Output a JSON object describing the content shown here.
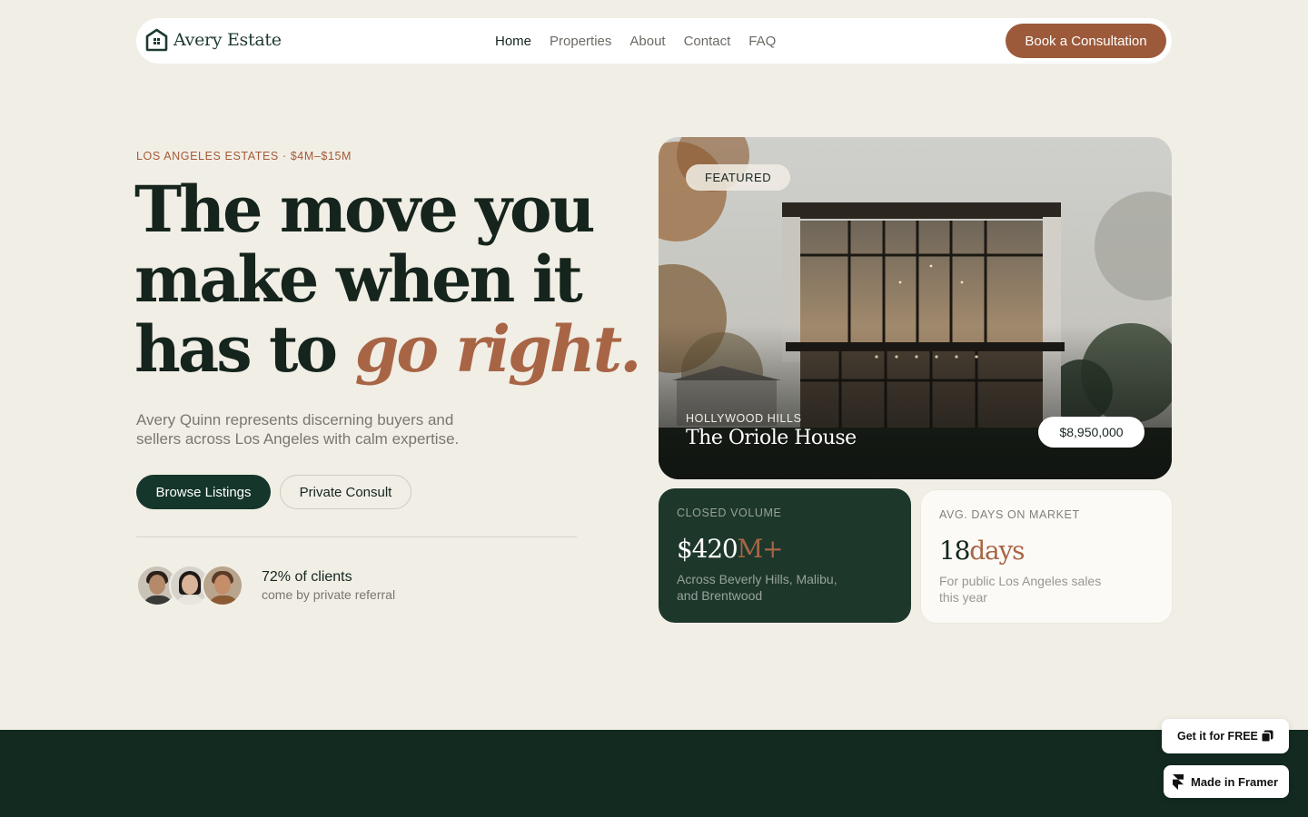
{
  "brand": {
    "name": "Avery Estate",
    "icon": "house-logo-icon"
  },
  "nav": {
    "links": [
      {
        "label": "Home",
        "active": true
      },
      {
        "label": "Properties",
        "active": false
      },
      {
        "label": "About",
        "active": false
      },
      {
        "label": "Contact",
        "active": false
      },
      {
        "label": "FAQ",
        "active": false
      }
    ],
    "cta_label": "Book a Consultation"
  },
  "hero": {
    "eyebrow": "LOS ANGELES ESTATES · $4M–$15M",
    "headline": {
      "line1": "The move you",
      "line2": "make when it",
      "line3_plain": "has to ",
      "line3_accent": "go right."
    },
    "lede": "Avery Quinn represents discerning buyers and sellers across Los Angeles with calm expertise.",
    "primary_button": "Browse Listings",
    "secondary_button": "Private Consult",
    "social_proof": {
      "title": "72% of clients",
      "subtitle": "come by private referral"
    }
  },
  "featured": {
    "tag": "FEATURED",
    "location": "HOLLYWOOD HILLS",
    "name": "The Oriole House",
    "price": "$8,950,000"
  },
  "stats": [
    {
      "label": "CLOSED VOLUME",
      "value": "$420",
      "unit": "M+",
      "description": "Across Beverly Hills, Malibu, and Brentwood"
    },
    {
      "label": "AVG. DAYS ON MARKET",
      "value": "18",
      "unit": "days",
      "description": "For public Los Angeles sales this year"
    }
  ],
  "badges": {
    "free_label": "Get it for FREE",
    "framer_label": "Made in Framer"
  },
  "colors": {
    "background": "#f1eee6",
    "accent": "#9c5a3a",
    "dark_green": "#15362a",
    "footer": "#132a21"
  }
}
